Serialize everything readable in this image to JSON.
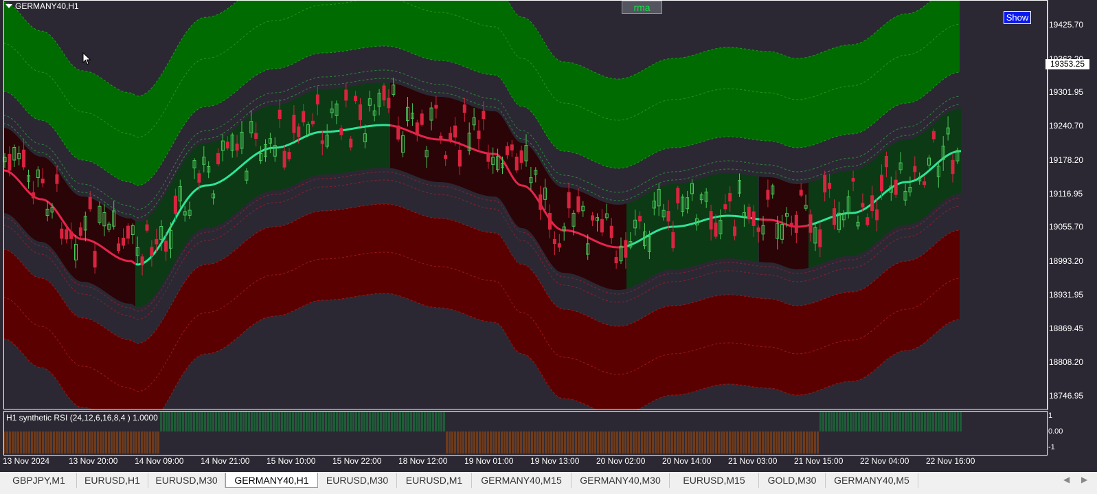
{
  "chart": {
    "symbol_title": "GERMANY40,H1",
    "indicator_button": "rma",
    "show_button": "Show",
    "current_price": "19353.25",
    "price_axis": [
      "19425.70",
      "19363.20",
      "19301.95",
      "19240.70",
      "19178.20",
      "19116.95",
      "19055.70",
      "18993.20",
      "18931.95",
      "18869.45",
      "18808.20",
      "18746.95"
    ],
    "time_axis": [
      "13 Nov 2024",
      "13 Nov 20:00",
      "14 Nov 09:00",
      "14 Nov 21:00",
      "15 Nov 10:00",
      "15 Nov 22:00",
      "18 Nov 12:00",
      "19 Nov 01:00",
      "19 Nov 13:00",
      "20 Nov 02:00",
      "20 Nov 14:00",
      "21 Nov 03:00",
      "21 Nov 15:00",
      "22 Nov 04:00",
      "22 Nov 16:00"
    ]
  },
  "subwindow": {
    "title": "H1 synthetic RSI  (24,12,6,16,8,4 ) 1.0000",
    "axis": [
      "1",
      "0.00",
      "-1"
    ]
  },
  "tabs": [
    "GBPJPY,M1",
    "EURUSD,H1",
    "EURUSD,M30",
    "GERMANY40,H1",
    "EURUSD,M30",
    "EURUSD,M1",
    "GERMANY40,M15",
    "GERMANY40,M30",
    "EURUSD,M15",
    "GOLD,M30",
    "GERMANY40,M5"
  ],
  "active_tab": "GERMANY40,H1",
  "colors": {
    "background": "#2b2833",
    "bull_zone": "#0c3a14",
    "bear_zone": "#2a0406",
    "upper_band": "#006b00",
    "lower_band": "#5a0000",
    "midline_bull": "#2ee59a",
    "midline_bear": "#e8234d",
    "candle_up": "#49c75a",
    "candle_down": "#d92440",
    "rsi_up": "#1f5c38",
    "rsi_down": "#6e3b1c"
  },
  "icons": [
    "dropdown-triangle-icon",
    "mouse-cursor-icon",
    "scroll-left-icon",
    "scroll-right-icon"
  ]
}
